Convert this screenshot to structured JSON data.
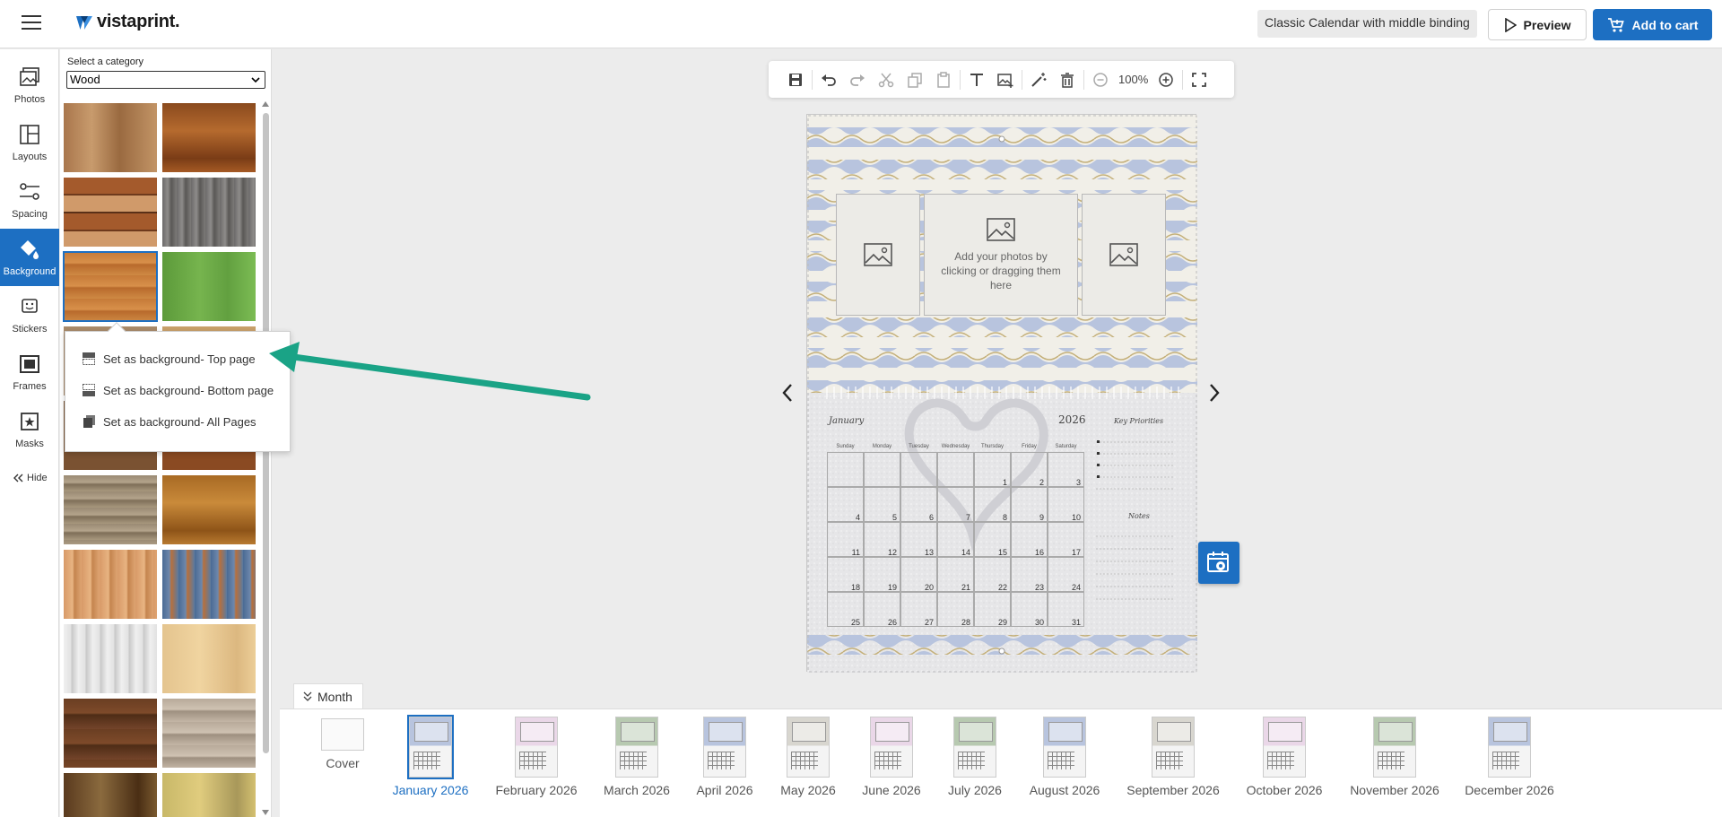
{
  "header": {
    "brand": "vistaprint.",
    "product_name": "Classic Calendar with middle binding",
    "preview_label": "Preview",
    "cart_label": "Add to cart",
    "brand_color": "#1d6fc2"
  },
  "rail": {
    "items": [
      {
        "label": "Photos",
        "icon": "photos-icon"
      },
      {
        "label": "Layouts",
        "icon": "layouts-icon"
      },
      {
        "label": "Spacing",
        "icon": "spacing-icon"
      },
      {
        "label": "Background",
        "icon": "paint-bucket-icon",
        "active": true
      },
      {
        "label": "Stickers",
        "icon": "sticker-icon"
      },
      {
        "label": "Frames",
        "icon": "frame-icon"
      },
      {
        "label": "Masks",
        "icon": "mask-icon"
      }
    ],
    "hide_label": "Hide"
  },
  "panel": {
    "title": "Select a category",
    "category": "Wood"
  },
  "context_menu": {
    "items": [
      {
        "label": "Set as background- Top page"
      },
      {
        "label": "Set as background- Bottom page"
      },
      {
        "label": "Set as background- All Pages"
      }
    ]
  },
  "toolbar": {
    "zoom": "100%"
  },
  "canvas": {
    "slot_text": "Add your photos by clicking or dragging them here",
    "month": "January",
    "year": "2026",
    "key_priorities": "Key Priorities",
    "notes": "Notes",
    "weekdays": [
      "Sunday",
      "Monday",
      "Tuesday",
      "Wednesday",
      "Thursday",
      "Friday",
      "Saturday"
    ],
    "days": [
      "",
      "",
      "",
      "",
      "1",
      "2",
      "3",
      "4",
      "5",
      "6",
      "7",
      "8",
      "9",
      "10",
      "11",
      "12",
      "13",
      "14",
      "15",
      "16",
      "17",
      "18",
      "19",
      "20",
      "21",
      "22",
      "23",
      "24",
      "25",
      "26",
      "27",
      "28",
      "29",
      "30",
      "31"
    ]
  },
  "month_strip": {
    "tab_label": "Month",
    "items": [
      {
        "label": "Cover"
      },
      {
        "label": "January 2026",
        "active": true
      },
      {
        "label": "February 2026"
      },
      {
        "label": "March 2026"
      },
      {
        "label": "April 2026"
      },
      {
        "label": "May 2026"
      },
      {
        "label": "June 2026"
      },
      {
        "label": "July 2026"
      },
      {
        "label": "August 2026"
      },
      {
        "label": "September 2026"
      },
      {
        "label": "October 2026"
      },
      {
        "label": "November 2026"
      },
      {
        "label": "December 2026"
      }
    ]
  }
}
